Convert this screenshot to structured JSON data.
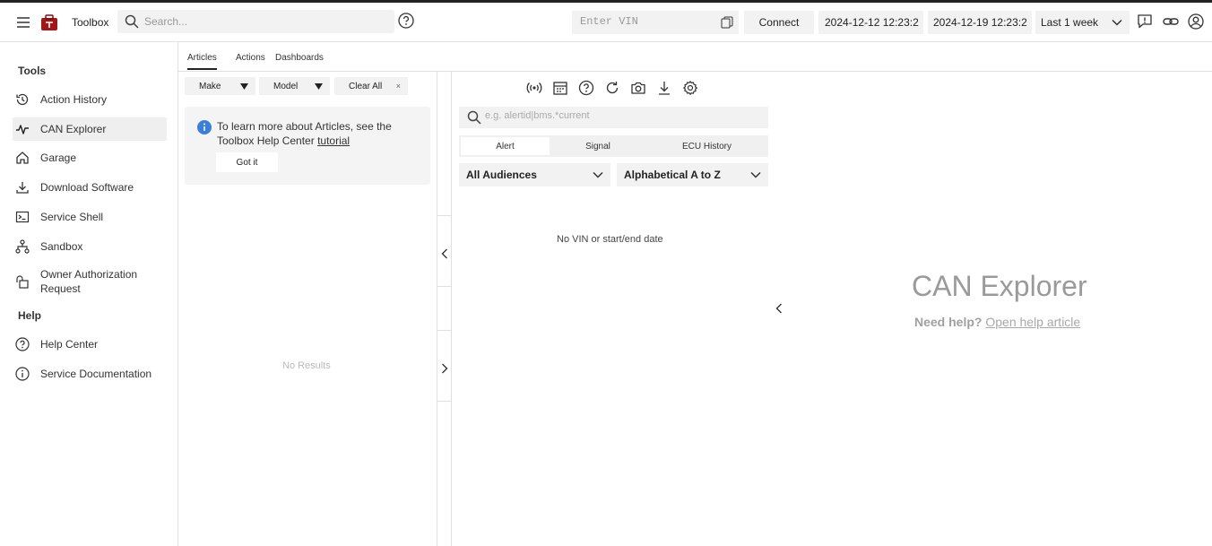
{
  "header": {
    "brand": "Toolbox",
    "search_placeholder": "Search...",
    "vin_placeholder": "Enter VIN",
    "connect_label": "Connect",
    "start_date": "2024-12-12 12:23:2",
    "end_date": "2024-12-19 12:23:2",
    "range_label": "Last 1 week",
    "icons": [
      "menu-icon",
      "toolbox-logo",
      "search-icon",
      "help-icon",
      "copy-icon",
      "chevron-down-icon",
      "feedback-icon",
      "link-icon",
      "user-icon"
    ]
  },
  "sidebar": {
    "tools_title": "Tools",
    "help_title": "Help",
    "items": [
      {
        "label": "Action History",
        "icon": "history-icon"
      },
      {
        "label": "CAN Explorer",
        "icon": "pulse-icon",
        "active": true
      },
      {
        "label": "Garage",
        "icon": "home-icon"
      },
      {
        "label": "Download Software",
        "icon": "download-icon"
      },
      {
        "label": "Service Shell",
        "icon": "terminal-icon"
      },
      {
        "label": "Sandbox",
        "icon": "sitemap-icon"
      },
      {
        "label": "Owner Authorization Request",
        "icon": "lock-icon"
      }
    ],
    "help_items": [
      {
        "label": "Help Center",
        "icon": "help-icon"
      },
      {
        "label": "Service Documentation",
        "icon": "info-icon"
      }
    ]
  },
  "articles": {
    "tabs": [
      "Articles",
      "Actions",
      "Dashboards"
    ],
    "make_label": "Make",
    "model_label": "Model",
    "clear_label": "Clear All",
    "clear_x": "×",
    "info_text_prefix": "To learn more about Articles, see the Toolbox Help Center ",
    "info_link": "tutorial",
    "gotit_label": "Got it",
    "no_results": "No Results"
  },
  "explorer": {
    "search_placeholder": "e.g. alertid|bms.*current",
    "segments": [
      "Alert",
      "Signal",
      "ECU History"
    ],
    "audience_label": "All Audiences",
    "sort_label": "Alphabetical A to Z",
    "empty_text": "No VIN or start/end date",
    "title": "CAN Explorer",
    "help_prefix": "Need help?",
    "help_link": "Open help article",
    "toolbar_icons": [
      "signal-icon",
      "calendar-icon",
      "help-icon",
      "refresh-icon",
      "camera-icon",
      "download-icon",
      "settings-icon"
    ]
  }
}
